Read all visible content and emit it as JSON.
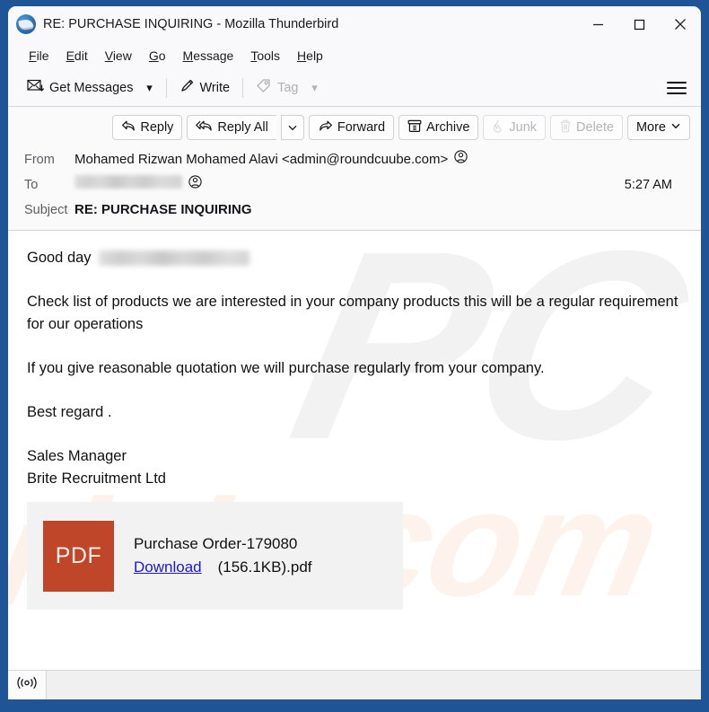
{
  "window": {
    "title": "RE: PURCHASE INQUIRING - Mozilla Thunderbird",
    "logo_icon": "thunderbird-logo",
    "controls": {
      "minimize": "minimize-icon",
      "maximize": "maximize-icon",
      "close": "close-icon"
    }
  },
  "menubar": {
    "items": [
      {
        "label": "File",
        "accel": "F"
      },
      {
        "label": "Edit",
        "accel": "E"
      },
      {
        "label": "View",
        "accel": "V"
      },
      {
        "label": "Go",
        "accel": "G"
      },
      {
        "label": "Message",
        "accel": "M"
      },
      {
        "label": "Tools",
        "accel": "T"
      },
      {
        "label": "Help",
        "accel": "H"
      }
    ]
  },
  "toolbar": {
    "get_messages_label": "Get Messages",
    "get_messages_icon": "envelope-download-icon",
    "get_messages_chevron": "chevron-down-icon",
    "write_label": "Write",
    "write_icon": "pencil-icon",
    "tag_label": "Tag",
    "tag_icon": "tag-icon",
    "tag_chevron": "chevron-down-icon",
    "tag_disabled": true,
    "app_menu_icon": "hamburger-menu-icon"
  },
  "message_actions": {
    "reply_label": "Reply",
    "reply_icon": "reply-arrow-icon",
    "reply_all_label": "Reply All",
    "reply_all_icon": "reply-all-arrow-icon",
    "reply_all_chevron": "chevron-down-icon",
    "forward_label": "Forward",
    "forward_icon": "forward-arrow-icon",
    "archive_label": "Archive",
    "archive_icon": "archive-box-icon",
    "junk_label": "Junk",
    "junk_icon": "flame-icon",
    "junk_disabled": true,
    "delete_label": "Delete",
    "delete_icon": "trash-icon",
    "delete_disabled": true,
    "more_label": "More",
    "more_chevron": "chevron-down-icon"
  },
  "headers": {
    "from_label": "From",
    "from_value": "Mohamed Rizwan Mohamed Alavi <admin@roundcuube.com>",
    "from_contact_icon": "contact-card-icon",
    "to_label": "To",
    "to_value": "",
    "to_redacted": true,
    "to_contact_icon": "contact-card-icon",
    "time": "5:27 AM",
    "subject_label": "Subject",
    "subject_value": "RE: PURCHASE INQUIRING"
  },
  "body": {
    "greeting": "Good day",
    "greeting_redacted": true,
    "paragraph_1": "Check list of products we are interested in your company products this will be a regular requirement for our operations",
    "paragraph_2": "If you give reasonable quotation we will purchase regularly from your company.",
    "paragraph_3": "Best regard .",
    "signature_line_1": "Sales Manager",
    "signature_line_2": "Brite Recruitment Ltd"
  },
  "attachment": {
    "type_label": "PDF",
    "file_name": "Purchase Order-179080",
    "download_label": "Download",
    "size_label": "(156.1KB).pdf",
    "icon_color": "#c0462a",
    "link_color": "#1a18d6"
  },
  "statusbar": {
    "indicator_icon": "broadcast-signal-icon"
  },
  "watermark": {
    "part_1": "PC",
    "part_2": "risk",
    "part_3": "com"
  },
  "colors": {
    "desktop_background": "#1f5497",
    "titlebar": "#f9f9fb",
    "toolbar": "#f9f9fb",
    "header_background": "#fafafa",
    "body_background": "#ffffff",
    "attachment_background": "#f2f2f2",
    "statusbar": "#f0f0f0"
  }
}
